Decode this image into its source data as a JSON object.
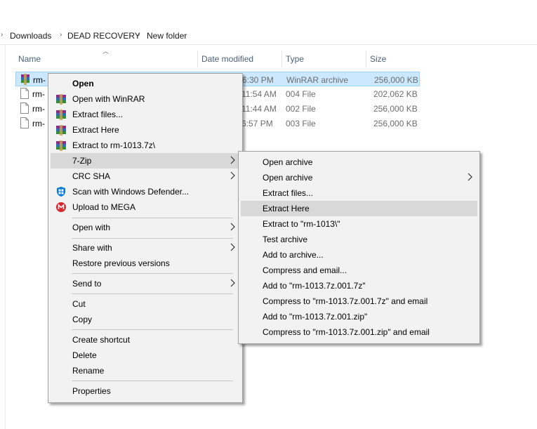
{
  "breadcrumb": [
    "Downloads",
    "DEAD RECOVERY",
    "New folder"
  ],
  "columns": {
    "name": "Name",
    "date": "Date modified",
    "type": "Type",
    "size": "Size"
  },
  "files": [
    {
      "name": "rm-",
      "date": "6:30 PM",
      "type": "WinRAR archive",
      "size": "256,000 KB",
      "selected": true
    },
    {
      "name": "rm-",
      "date": "11:54 AM",
      "type": "004 File",
      "size": "202,062 KB"
    },
    {
      "name": "rm-",
      "date": "11:44 AM",
      "type": "002 File",
      "size": "256,000 KB"
    },
    {
      "name": "rm-",
      "date": "6:57 PM",
      "type": "003 File",
      "size": "256,000 KB"
    }
  ],
  "context_menu": {
    "open": "Open",
    "open_with_winrar": "Open with WinRAR",
    "extract_files": "Extract files...",
    "extract_here": "Extract Here",
    "extract_to": "Extract to rm-1013.7z\\",
    "seven_zip": "7-Zip",
    "crc_sha": "CRC SHA",
    "scan_defender": "Scan with Windows Defender...",
    "upload_mega": "Upload to MEGA",
    "open_with": "Open with",
    "share_with": "Share with",
    "restore_versions": "Restore previous versions",
    "send_to": "Send to",
    "cut": "Cut",
    "copy": "Copy",
    "create_shortcut": "Create shortcut",
    "delete": "Delete",
    "rename": "Rename",
    "properties": "Properties"
  },
  "submenu_7zip": [
    "Open archive",
    "Open archive",
    "Extract files...",
    "Extract Here",
    "Extract to \"rm-1013\\\"",
    "Test archive",
    "Add to archive...",
    "Compress and email...",
    "Add to \"rm-1013.7z.001.7z\"",
    "Compress to \"rm-1013.7z.001.7z\" and email",
    "Add to \"rm-1013.7z.001.zip\"",
    "Compress to \"rm-1013.7z.001.zip\" and email"
  ],
  "colors": {
    "selection": "#cce8ff",
    "menu_bg": "#f2f2f2",
    "menu_highlight": "#d8d8d8",
    "header_text": "#4c607a",
    "mega_red": "#d9272e",
    "defender_blue": "#0078d7"
  },
  "icons": {
    "winrar": "winrar-icon",
    "file": "file-icon",
    "defender": "windows-defender-icon",
    "mega": "mega-icon",
    "submenu": "chevron-right-icon",
    "sort": "sort-up-icon"
  }
}
